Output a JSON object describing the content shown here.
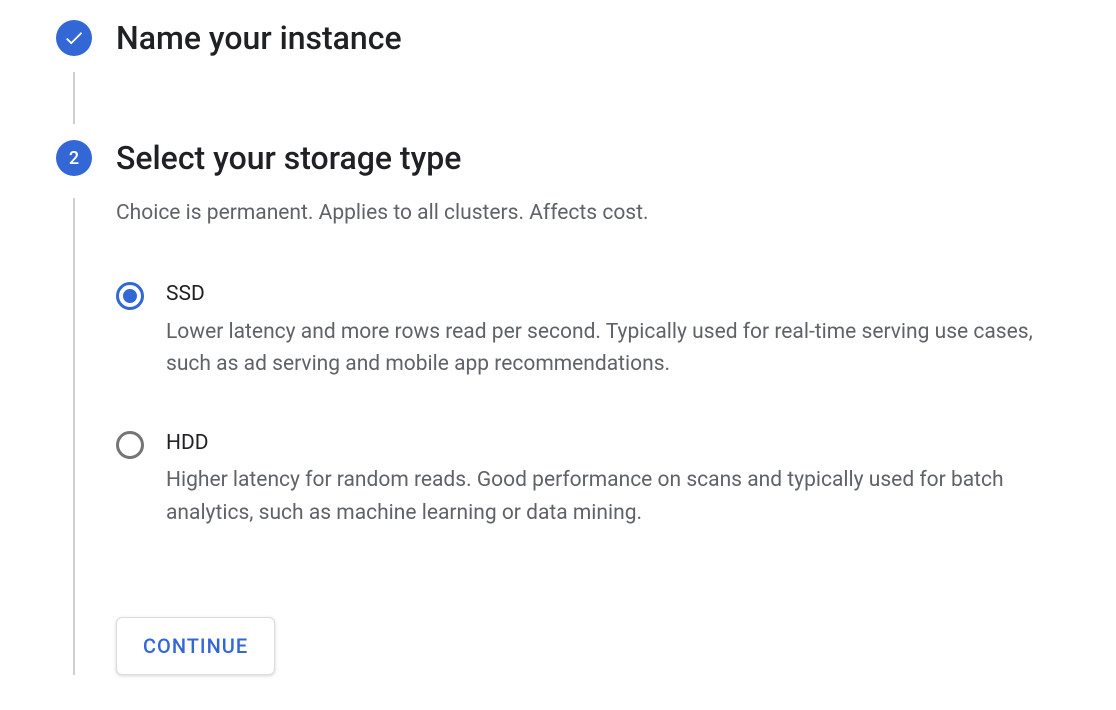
{
  "steps": {
    "step1": {
      "title": "Name your instance"
    },
    "step2": {
      "number": "2",
      "title": "Select your storage type",
      "description": "Choice is permanent. Applies to all clusters. Affects cost.",
      "options": {
        "ssd": {
          "label": "SSD",
          "description": "Lower latency and more rows read per second. Typically used for real-time serving use cases, such as ad serving and mobile app recommendations."
        },
        "hdd": {
          "label": "HDD",
          "description": "Higher latency for random reads. Good performance on scans and typically used for batch analytics, such as machine learning or data mining."
        }
      },
      "continue_label": "Continue"
    }
  }
}
